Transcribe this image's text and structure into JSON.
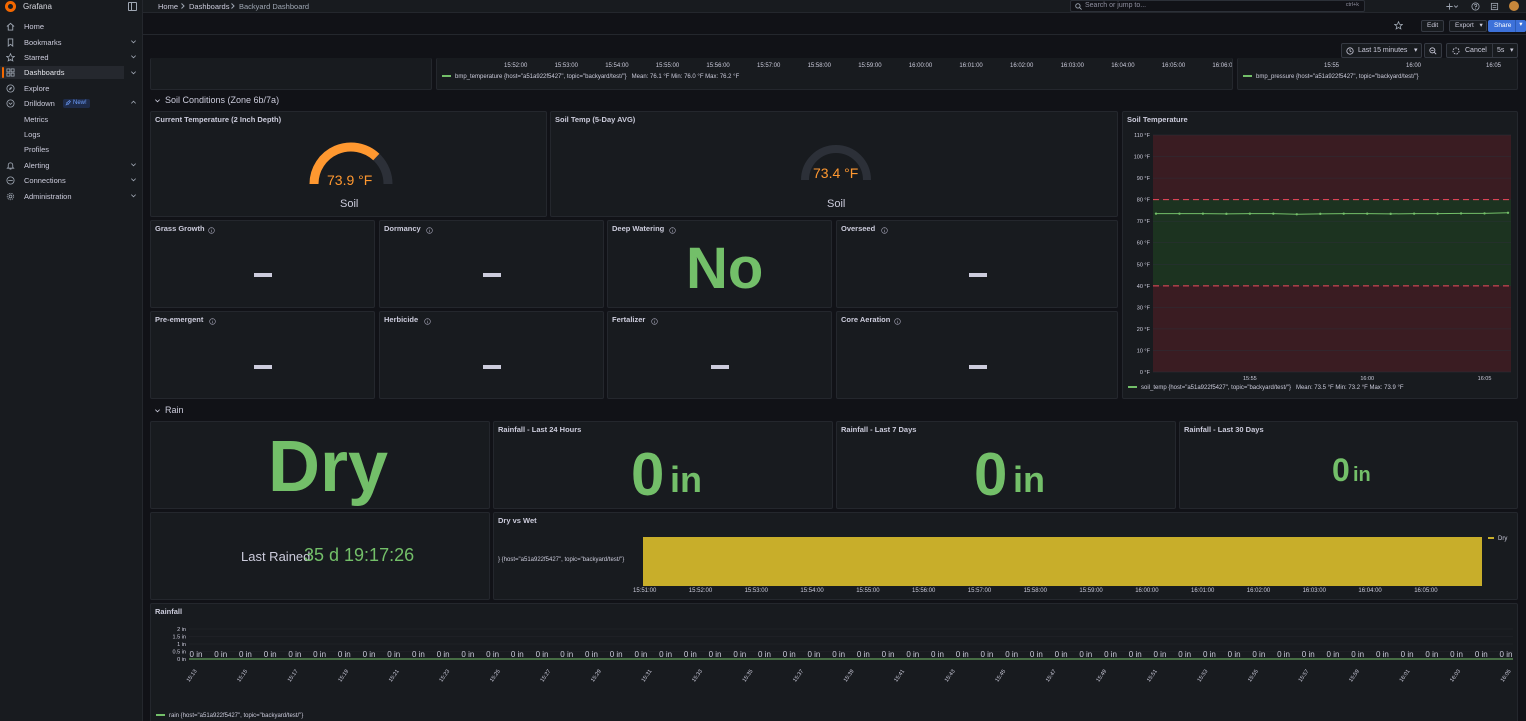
{
  "app": {
    "name": "Grafana",
    "colors": {
      "background": "#111217",
      "panel": "#181b1f",
      "accent": "#f46800",
      "green": "#73bf69",
      "red": "#f2495c",
      "yellow": "#c8ae2a",
      "primary": "#3d71d9"
    }
  },
  "sidebar": {
    "items": [
      {
        "label": "Home",
        "icon": "home-icon"
      },
      {
        "label": "Bookmarks",
        "icon": "bookmark-icon"
      },
      {
        "label": "Starred",
        "icon": "star-icon"
      },
      {
        "label": "Dashboards",
        "icon": "apps-icon",
        "active": true
      },
      {
        "label": "Explore",
        "icon": "compass-icon"
      },
      {
        "label": "Drilldown",
        "icon": "drilldown-icon",
        "badge": "New!"
      },
      {
        "label": "Metrics"
      },
      {
        "label": "Logs"
      },
      {
        "label": "Profiles"
      },
      {
        "label": "Alerting",
        "icon": "bell-icon"
      },
      {
        "label": "Connections",
        "icon": "link-icon"
      },
      {
        "label": "Administration",
        "icon": "cog-icon"
      }
    ]
  },
  "topbar": {
    "breadcrumbs": [
      "Home",
      "Dashboards",
      "Backyard Dashboard"
    ],
    "search_placeholder": "Search or jump to...",
    "search_shortcut": "ctrl+k"
  },
  "toolbar": {
    "edit_label": "Edit",
    "export_label": "Export",
    "share_label": "Share",
    "time_range": "Last 15 minutes",
    "cancel_label": "Cancel",
    "refresh_interval": "5s"
  },
  "top_panels": {
    "temp_x_ticks": [
      "15:52:00",
      "15:53:00",
      "15:54:00",
      "15:55:00",
      "15:56:00",
      "15:57:00",
      "15:58:00",
      "15:59:00",
      "16:00:00",
      "16:01:00",
      "16:02:00",
      "16:03:00",
      "16:04:00",
      "16:05:00",
      "16:06:0"
    ],
    "temp_legend": "bmp_temperature {host=\"a51a922f5427\", topic=\"backyard/test/\"}",
    "temp_stats": "Mean: 76.1 °F   Min: 76.0 °F   Max: 76.2 °F",
    "pressure_x_ticks": [
      "15:55",
      "16:00",
      "16:05"
    ],
    "pressure_legend": "bmp_pressure {host=\"a51a922f5427\", topic=\"backyard/test/\"}"
  },
  "soil_row": {
    "title": "Soil Conditions (Zone 6b/7a)",
    "current_temp": {
      "title": "Current Temperature (2 Inch Depth)",
      "value": "73.9 °F",
      "label": "Soil",
      "fraction": 0.74
    },
    "avg_temp": {
      "title": "Soil Temp (5-Day AVG)",
      "value": "73.4 °F",
      "label": "Soil",
      "fraction": 0.73
    },
    "status_panels": [
      {
        "title": "Grass Growth",
        "value": ""
      },
      {
        "title": "Dormancy",
        "value": ""
      },
      {
        "title": "Deep Watering",
        "value": "No"
      },
      {
        "title": "Overseed",
        "value": ""
      },
      {
        "title": "Pre-emergent",
        "value": ""
      },
      {
        "title": "Herbicide",
        "value": ""
      },
      {
        "title": "Fertalizer",
        "value": ""
      },
      {
        "title": "Core Aeration",
        "value": ""
      }
    ]
  },
  "soil_chart": {
    "title": "Soil Temperature",
    "legend": "soil_temp {host=\"a51a922f5427\", topic=\"backyard/test/\"}",
    "stats": "Mean: 73.5 °F   Min: 73.2 °F   Max: 73.9 °F"
  },
  "rain_row": {
    "title": "Rain",
    "status": "Dry",
    "rain_24h": {
      "title": "Rainfall - Last 24 Hours",
      "value": "0",
      "unit": "in"
    },
    "rain_7d": {
      "title": "Rainfall - Last 7 Days",
      "value": "0",
      "unit": "in"
    },
    "rain_30d": {
      "title": "Rainfall - Last 30 Days",
      "value": "0",
      "unit": "in"
    },
    "last_rained_label": "Last Rained",
    "last_rained_value": "35 d 19:17:26",
    "dry_wet": {
      "title": "Dry vs Wet",
      "row_label": "} {host=\"a51a922f5427\", topic=\"backyard/test/\"}",
      "legend": "Dry"
    }
  },
  "rainfall_chart": {
    "title": "Rainfall",
    "legend": "rain {host=\"a51a922f5427\", topic=\"backyard/test/\"}"
  },
  "chart_data": [
    {
      "type": "line",
      "title": "Soil Temperature",
      "x": [
        "15:51",
        "15:52",
        "15:53",
        "15:54",
        "15:55",
        "15:56",
        "15:57",
        "15:58",
        "15:59",
        "16:00",
        "16:01",
        "16:02",
        "16:03",
        "16:04",
        "16:05",
        "16:06"
      ],
      "x_ticks": [
        "15:55",
        "16:00",
        "16:05"
      ],
      "series": [
        {
          "name": "soil_temp {host=\"a51a922f5427\", topic=\"backyard/test/\"}",
          "values": [
            73.5,
            73.5,
            73.5,
            73.4,
            73.5,
            73.5,
            73.2,
            73.4,
            73.5,
            73.5,
            73.4,
            73.5,
            73.5,
            73.6,
            73.6,
            73.9
          ]
        }
      ],
      "y_ticks": [
        "0 °F",
        "10 °F",
        "20 °F",
        "30 °F",
        "40 °F",
        "50 °F",
        "60 °F",
        "70 °F",
        "80 °F",
        "90 °F",
        "100 °F",
        "110 °F"
      ],
      "ylim": [
        0,
        110
      ],
      "thresholds": [
        40,
        80
      ],
      "grid": true
    },
    {
      "type": "bar",
      "title": "Dry vs Wet",
      "x_ticks": [
        "15:51:00",
        "15:52:00",
        "15:53:00",
        "15:54:00",
        "15:55:00",
        "15:56:00",
        "15:57:00",
        "15:58:00",
        "15:59:00",
        "16:00:00",
        "16:01:00",
        "16:02:00",
        "16:03:00",
        "16:04:00",
        "16:05:00"
      ],
      "series": [
        {
          "name": "Dry",
          "values": [
            1
          ]
        }
      ]
    },
    {
      "type": "bar",
      "title": "Rainfall",
      "y_ticks": [
        "0 in",
        "0.5 in",
        "1 in",
        "1.5 in",
        "2 in"
      ],
      "ylim": [
        0,
        2
      ],
      "x_ticks": [
        "15:13",
        "15:15",
        "15:17",
        "15:19",
        "15:21",
        "15:23",
        "15:25",
        "15:27",
        "15:29",
        "15:31",
        "15:33",
        "15:35",
        "15:37",
        "15:39",
        "15:41",
        "15:43",
        "15:45",
        "15:47",
        "15:49",
        "15:51",
        "15:53",
        "15:55",
        "15:57",
        "15:59",
        "16:01",
        "16:03",
        "16:05"
      ],
      "series": [
        {
          "name": "rain {host=\"a51a922f5427\", topic=\"backyard/test/\"}",
          "values": [
            0,
            0,
            0,
            0,
            0,
            0,
            0,
            0,
            0,
            0,
            0,
            0,
            0,
            0,
            0,
            0,
            0,
            0,
            0,
            0,
            0,
            0,
            0,
            0,
            0,
            0,
            0,
            0,
            0,
            0,
            0,
            0,
            0,
            0,
            0,
            0,
            0,
            0,
            0,
            0,
            0,
            0,
            0,
            0,
            0,
            0,
            0,
            0,
            0,
            0,
            0,
            0,
            0,
            0
          ]
        }
      ],
      "data_label": "0 in"
    }
  ]
}
